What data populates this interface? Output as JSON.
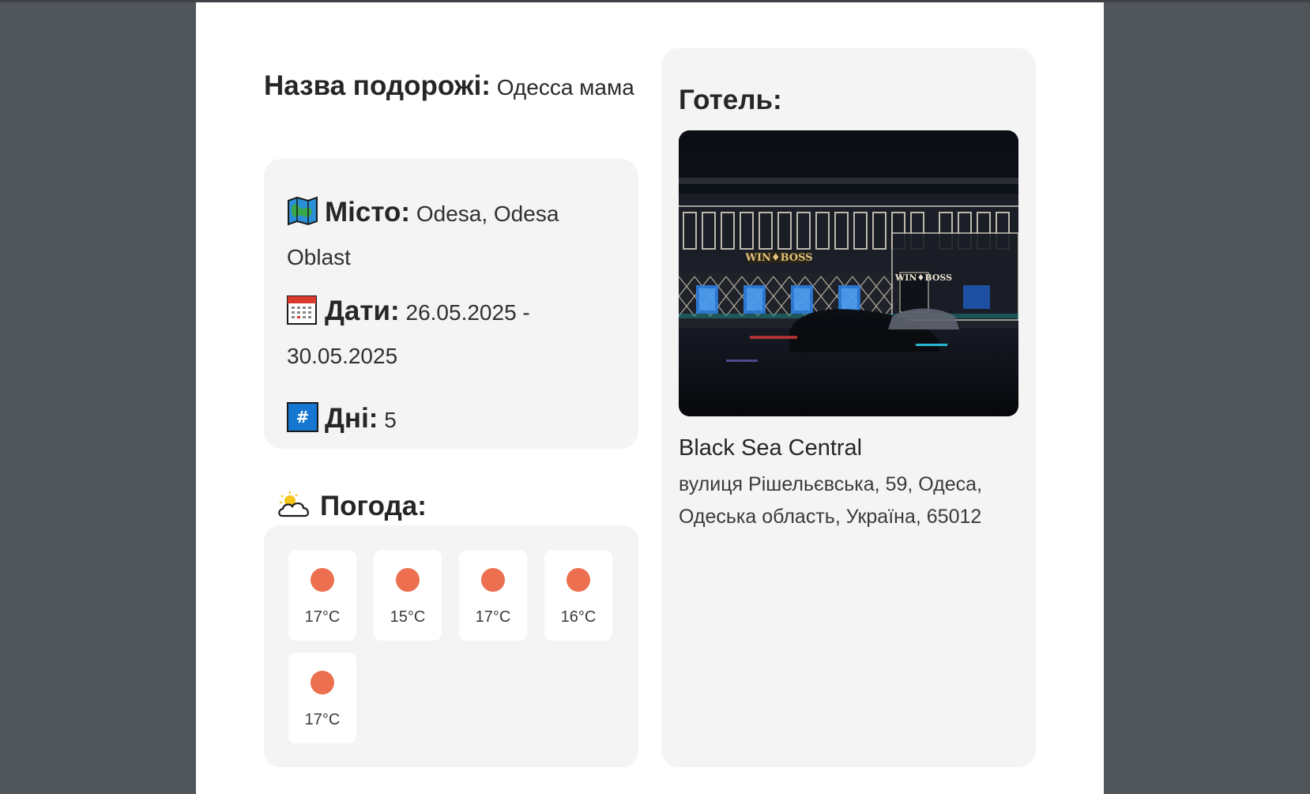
{
  "trip": {
    "label": "Назва подорожі:",
    "value": "Одесса мама"
  },
  "details": {
    "city_label": "Місто:",
    "city_value": "Odesa, Odesa Oblast",
    "dates_label": "Дати:",
    "dates_value": "26.05.2025 - 30.05.2025",
    "days_label": "Дні:",
    "days_value": "5"
  },
  "weather": {
    "label": "Погода:",
    "days": [
      {
        "temp": "17°C",
        "icon": "sun-icon"
      },
      {
        "temp": "15°C",
        "icon": "sun-icon"
      },
      {
        "temp": "17°C",
        "icon": "sun-icon"
      },
      {
        "temp": "16°C",
        "icon": "sun-icon"
      },
      {
        "temp": "17°C",
        "icon": "sun-icon"
      }
    ]
  },
  "hotel": {
    "label": "Готель:",
    "name": "Black Sea Central",
    "address": "вулиця Рішельєвська, 59, Одеса, Одеська область, Україна, 65012"
  },
  "colors": {
    "sun": "#ec7050",
    "card": "#f4f4f4",
    "background": "#50555a"
  }
}
